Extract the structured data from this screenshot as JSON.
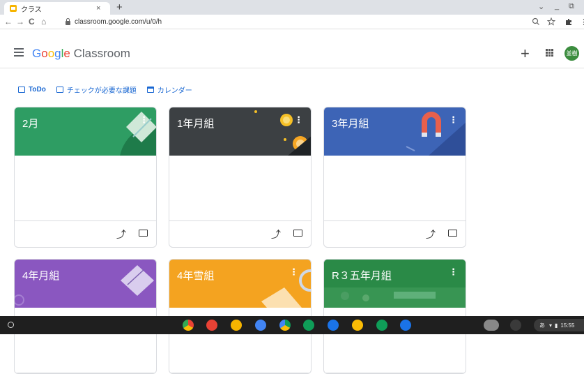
{
  "browser": {
    "tab_title": "クラス",
    "tab_close": "×",
    "new_tab": "+",
    "url": "classroom.google.com/u/0/h",
    "nav": {
      "back": "←",
      "forward": "→",
      "reload": "C",
      "home": "⌂"
    },
    "window_controls": {
      "menu": "⌄",
      "minimize": "_",
      "maximize": "⧉"
    }
  },
  "app": {
    "logo_google": [
      "G",
      "o",
      "o",
      "g",
      "l",
      "e"
    ],
    "logo_product": "Classroom",
    "add_label": "+",
    "avatar_text": "並樹"
  },
  "links": {
    "todo": "ToDo",
    "review": "チェックが必要な課題",
    "calendar": "カレンダー"
  },
  "classes": [
    {
      "name": "2月",
      "color": "#2e9d63"
    },
    {
      "name": "1年月組",
      "color": "#3c4043"
    },
    {
      "name": "3年月組",
      "color": "#3d64b6"
    },
    {
      "name": "4年月組",
      "color": "#8a57c0"
    },
    {
      "name": "4年雪組",
      "color": "#f4a320"
    },
    {
      "name": "R３五年月組",
      "color": "#1e7e3e"
    }
  ],
  "card_icons": {
    "more": "⋮",
    "trend": "⤴"
  },
  "shelf": {
    "apps": [
      "chrome-icon",
      "photos-icon",
      "keep-icon",
      "docs-icon",
      "drive-icon",
      "sheets-icon",
      "files-icon",
      "pencil-icon",
      "classroom-icon",
      "camera-icon"
    ],
    "ime": "あ",
    "time": "15:55"
  }
}
